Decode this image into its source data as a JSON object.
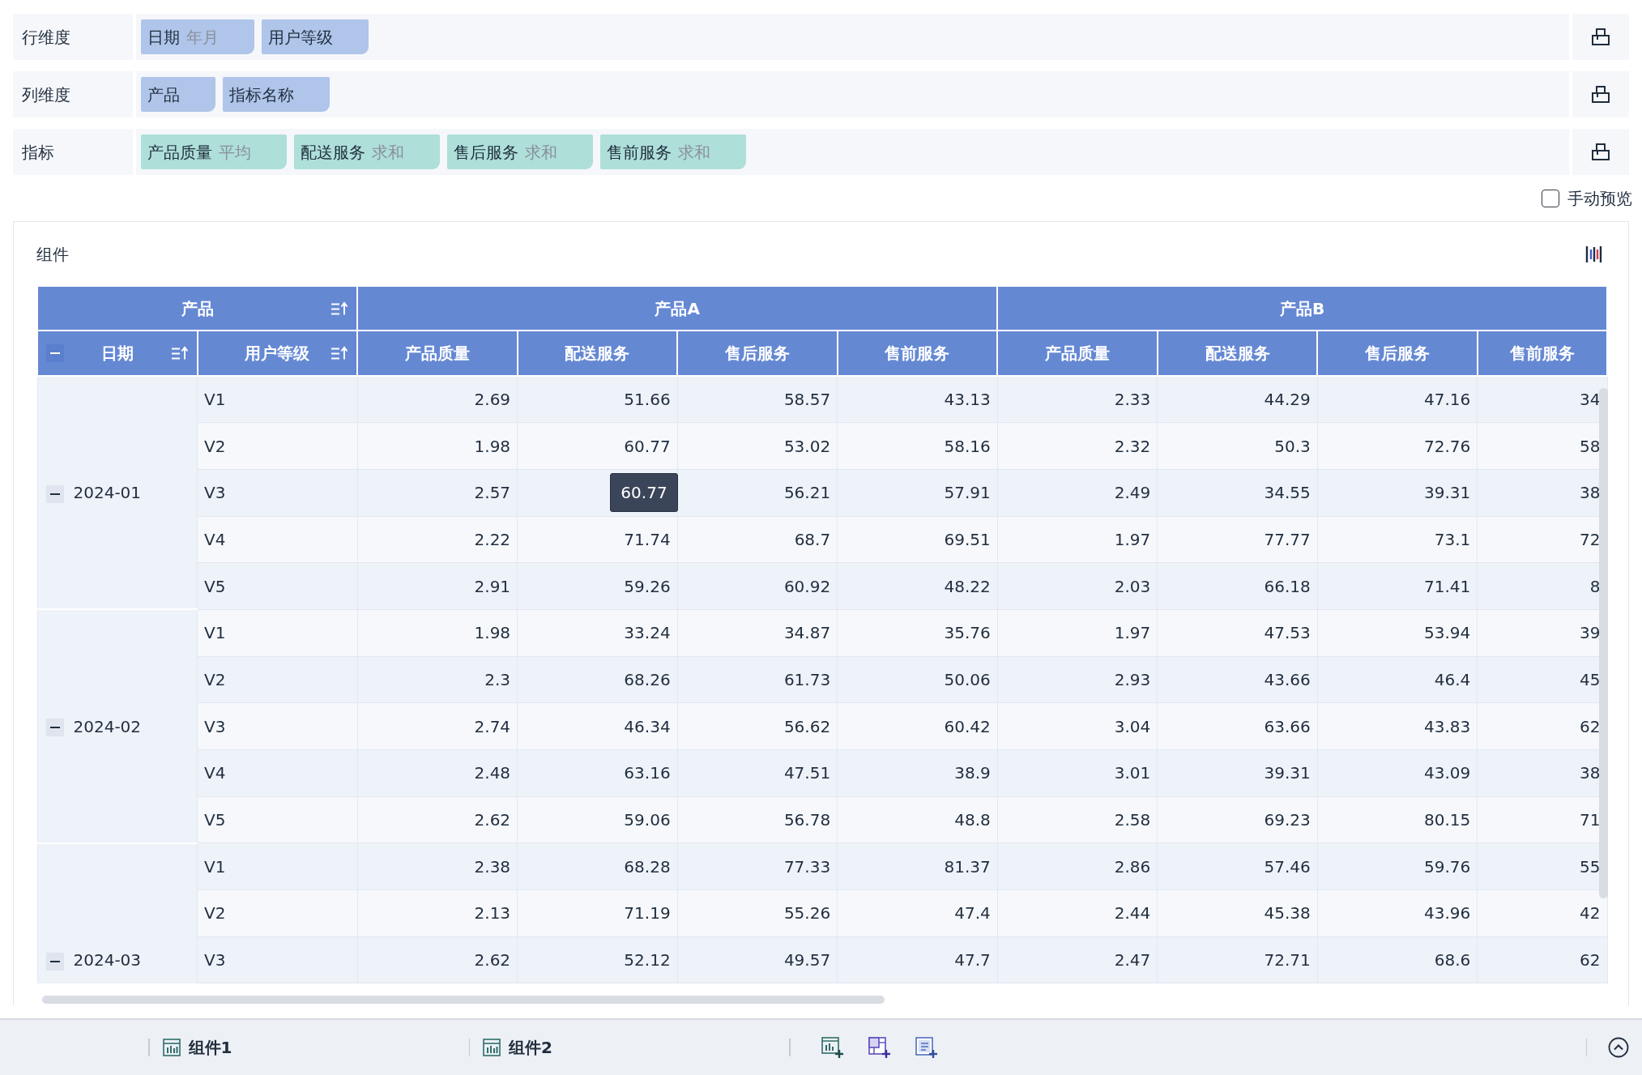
{
  "config_rows": [
    {
      "label": "行维度",
      "kind": "dimension",
      "pills": [
        {
          "name": "日期",
          "suffix": "年月"
        },
        {
          "name": "用户等级"
        }
      ]
    },
    {
      "label": "列维度",
      "kind": "dimension",
      "pills": [
        {
          "name": "产品"
        },
        {
          "name": "指标名称"
        }
      ]
    },
    {
      "label": "指标",
      "kind": "measure",
      "pills": [
        {
          "name": "产品质量",
          "suffix": "平均"
        },
        {
          "name": "配送服务",
          "suffix": "求和"
        },
        {
          "name": "售后服务",
          "suffix": "求和"
        },
        {
          "name": "售前服务",
          "suffix": "求和"
        }
      ]
    }
  ],
  "manual_preview": {
    "label": "手动预览",
    "checked": false
  },
  "panel": {
    "title": "组件"
  },
  "table": {
    "header_top": [
      {
        "text": "产品",
        "kind": "dimension",
        "sortable": true
      },
      {
        "text": "产品A",
        "kind": "measure"
      },
      {
        "text": "产品B",
        "kind": "measure"
      }
    ],
    "columns": [
      {
        "text": "日期",
        "kind": "dimension",
        "sortable": true,
        "expanded": true
      },
      {
        "text": "用户等级",
        "kind": "dimension",
        "sortable": true
      },
      {
        "text": "产品质量",
        "kind": "measure"
      },
      {
        "text": "配送服务",
        "kind": "measure"
      },
      {
        "text": "售后服务",
        "kind": "measure"
      },
      {
        "text": "售前服务",
        "kind": "measure"
      },
      {
        "text": "产品质量",
        "kind": "measure"
      },
      {
        "text": "配送服务",
        "kind": "measure"
      },
      {
        "text": "售后服务",
        "kind": "measure"
      },
      {
        "text": "售前服务",
        "kind": "measure"
      }
    ],
    "groups": [
      {
        "date": "2024-01",
        "expanded": true,
        "rows": [
          {
            "label": "V1",
            "values": [
              "2.69",
              "51.66",
              "58.57",
              "43.13",
              "2.33",
              "44.29",
              "47.16",
              "34"
            ]
          },
          {
            "label": "V2",
            "values": [
              "1.98",
              "60.77",
              "53.02",
              "58.16",
              "2.32",
              "50.3",
              "72.76",
              "58"
            ]
          },
          {
            "label": "V3",
            "values": [
              "2.57",
              {
                "tooltip": "60.77"
              },
              "56.21",
              "57.91",
              "2.49",
              "34.55",
              "39.31",
              "38"
            ]
          },
          {
            "label": "V4",
            "values": [
              "2.22",
              "71.74",
              "68.7",
              "69.51",
              "1.97",
              "77.77",
              "73.1",
              "72"
            ]
          },
          {
            "label": "V5",
            "values": [
              "2.91",
              "59.26",
              "60.92",
              "48.22",
              "2.03",
              "66.18",
              "71.41",
              "8"
            ]
          }
        ]
      },
      {
        "date": "2024-02",
        "expanded": true,
        "rows": [
          {
            "label": "V1",
            "values": [
              "1.98",
              "33.24",
              "34.87",
              "35.76",
              "1.97",
              "47.53",
              "53.94",
              "39"
            ]
          },
          {
            "label": "V2",
            "values": [
              "2.3",
              "68.26",
              "61.73",
              "50.06",
              "2.93",
              "43.66",
              "46.4",
              "45"
            ]
          },
          {
            "label": "V3",
            "values": [
              "2.74",
              "46.34",
              "56.62",
              "60.42",
              "3.04",
              "63.66",
              "43.83",
              "62"
            ]
          },
          {
            "label": "V4",
            "values": [
              "2.48",
              "63.16",
              "47.51",
              "38.9",
              "3.01",
              "39.31",
              "43.09",
              "38"
            ]
          },
          {
            "label": "V5",
            "values": [
              "2.62",
              "59.06",
              "56.78",
              "48.8",
              "2.58",
              "69.23",
              "80.15",
              "71"
            ]
          }
        ]
      },
      {
        "date": "2024-03",
        "expanded": true,
        "rows": [
          {
            "label": "V1",
            "values": [
              "2.38",
              "68.28",
              "77.33",
              "81.37",
              "2.86",
              "57.46",
              "59.76",
              "55"
            ]
          },
          {
            "label": "V2",
            "values": [
              "2.13",
              "71.19",
              "55.26",
              "47.4",
              "2.44",
              "45.38",
              "43.96",
              "42"
            ]
          },
          {
            "label": "V3",
            "values": [
              "2.62",
              "52.12",
              "49.57",
              "47.7",
              "2.47",
              "72.71",
              "68.6",
              "62"
            ]
          }
        ]
      }
    ]
  },
  "bottom_tabs": [
    {
      "label": "组件1"
    },
    {
      "label": "组件2"
    }
  ]
}
